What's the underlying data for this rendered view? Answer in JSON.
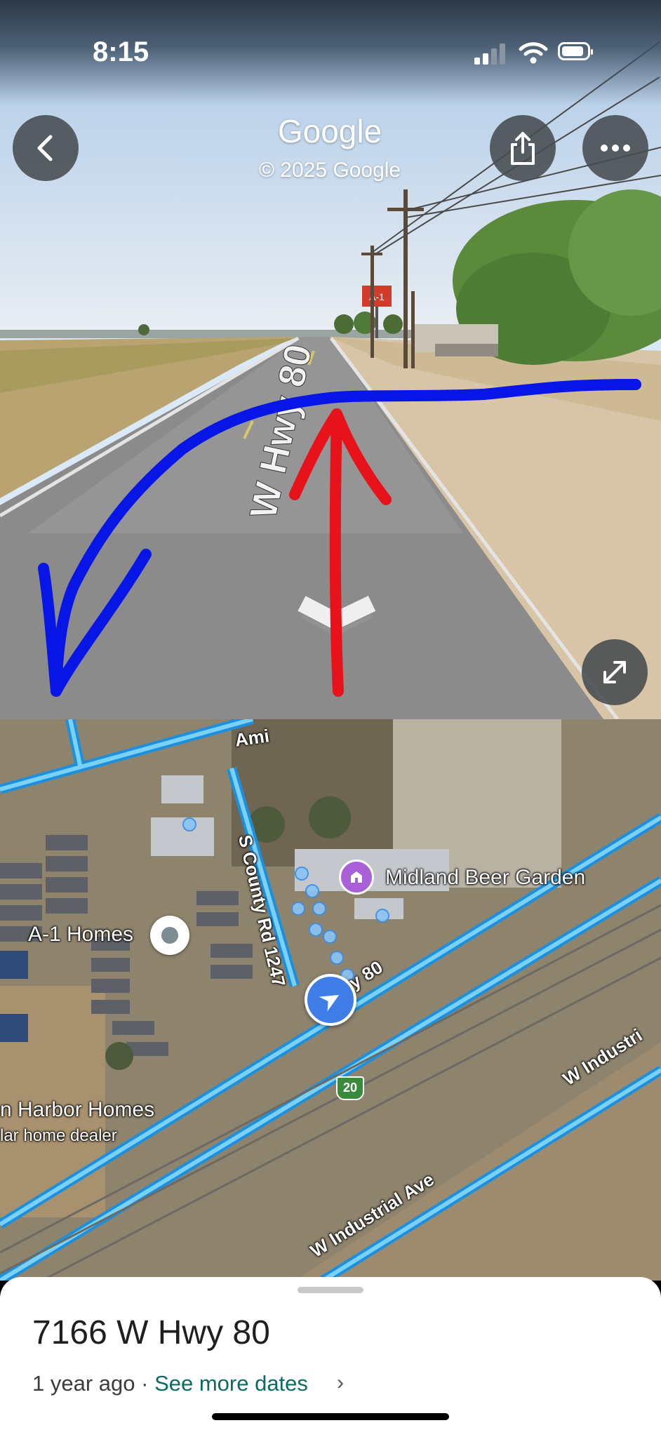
{
  "status_bar": {
    "time": "8:15"
  },
  "street_view": {
    "title": "Google",
    "copyright": "© 2025 Google",
    "road_marking": "W Hwy 80",
    "billboard": "A-1"
  },
  "map": {
    "labels": {
      "beer_garden": "Midland Beer Garden",
      "a1_homes": "A-1 Homes",
      "harbor_homes": "n Harbor Homes",
      "harbor_sub": "lar home dealer",
      "county_rd": "S County Rd 1247",
      "hwy80": "W Hwy 80",
      "ind_ave_1": "W Industrial Ave",
      "ind_ave_2": "W Industri",
      "top_road": "Ami",
      "interstate": "20"
    }
  },
  "sheet": {
    "address": "7166 W Hwy 80",
    "age": "1 year ago",
    "separator": " · ",
    "see_more": "See more dates",
    "chevron": "›"
  },
  "icons": [
    "back-arrow-icon",
    "share-icon",
    "more-dots-icon",
    "expand-icon",
    "purple-landmark-icon",
    "location-arrow-icon",
    "chevron-right-icon"
  ]
}
